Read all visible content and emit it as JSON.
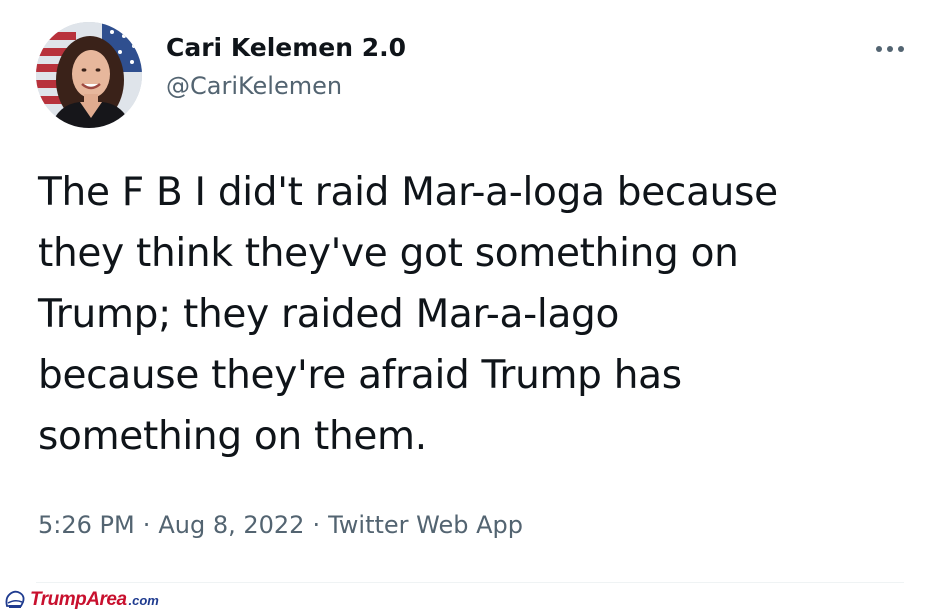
{
  "tweet": {
    "author": {
      "display_name": "Cari Kelemen 2.0",
      "handle": "@CariKelemen"
    },
    "more_icon": "more-horizontal-icon",
    "text": "The F B I did't raid Mar-a-loga because\nthey think they've got something on\nTrump; they raided Mar-a-lago\nbecause they're afraid Trump has\nsomething on them.",
    "meta": {
      "time": "5:26 PM",
      "separator": "·",
      "date": "Aug 8, 2022",
      "source": "Twitter Web App"
    }
  },
  "watermark": {
    "brand": "TrumpArea",
    "domain": ".com"
  },
  "colors": {
    "text_primary": "#0f1419",
    "text_secondary": "#536471",
    "watermark_red": "#c8102e",
    "watermark_blue": "#1f3b8f"
  }
}
